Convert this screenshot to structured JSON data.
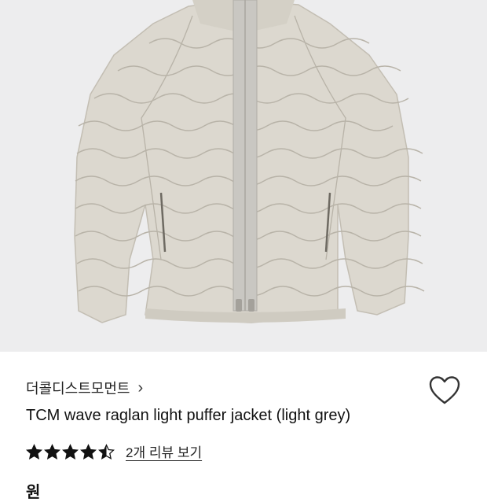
{
  "product": {
    "image_alt": "TCM wave raglan light puffer jacket",
    "brand": "더콜디스트모먼트",
    "brand_chevron": "›",
    "title": "TCM wave raglan light puffer jacket (light grey)",
    "rating_value": 4.5,
    "review_link": "2개 리뷰 보기",
    "price_peek": "원"
  },
  "icons": {
    "wishlist": "heart-outline-icon",
    "star": "star-icon",
    "chevron": "chevron-right-icon"
  },
  "colors": {
    "hero_bg": "#ededee",
    "jacket": "#d9d5cc",
    "stitch": "#b5b0a6",
    "zipper": "#c9c7c2"
  }
}
